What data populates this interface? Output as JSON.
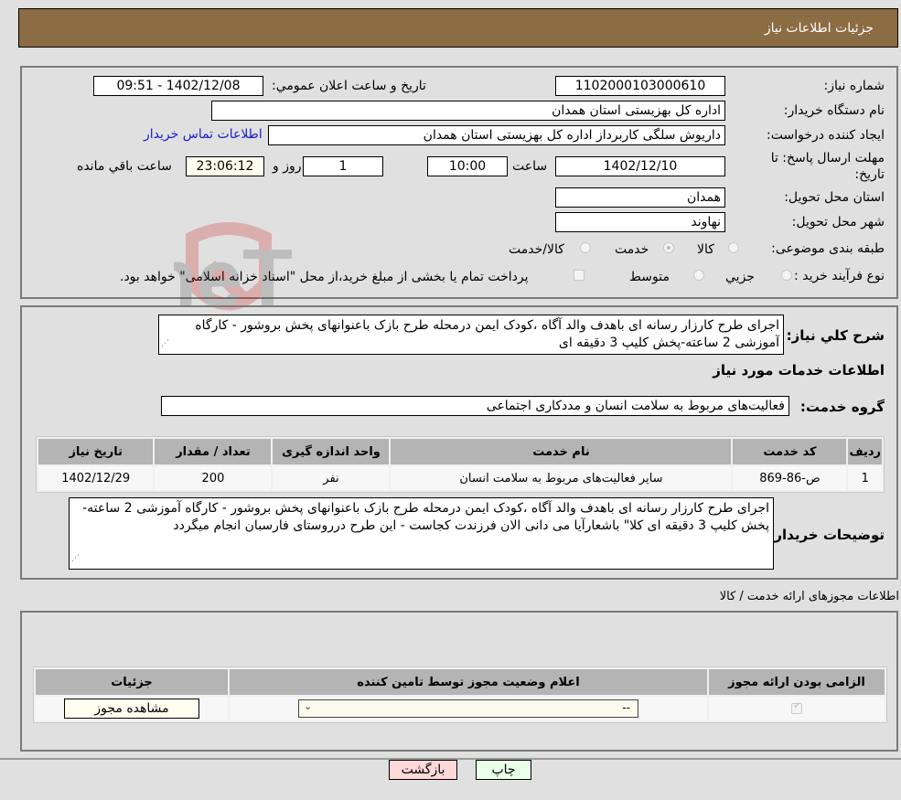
{
  "header": {
    "title": "جزئیات اطلاعات نیاز"
  },
  "details": {
    "need_number_label": "شماره نیاز:",
    "need_number": "1102000103000610",
    "announce_label": "تاریخ و ساعت اعلان عمومي:",
    "announce_value": "1402/12/08 - 09:51",
    "buyer_org_label": "نام دستگاه خریدار:",
    "buyer_org": "اداره کل بهزیستی استان همدان",
    "creator_label": "ایجاد کننده درخواست:",
    "creator": "داریوش سلگی کاربرداز اداره کل بهزیستی استان همدان",
    "contact_link": "اطلاعات تماس خریدار",
    "deadline_label": "مهلت ارسال پاسخ: تا تاریخ:",
    "deadline_date": "1402/12/10",
    "time_label": "ساعت",
    "deadline_time": "10:00",
    "days_value": "1",
    "days_label": "روز و",
    "remaining_time": "23:06:12",
    "remaining_label": "ساعت باقي مانده",
    "province_label": "استان محل تحویل:",
    "province": "همدان",
    "city_label": "شهر محل تحویل:",
    "city": "نهاوند",
    "category_label": "طبقه بندی موضوعی:",
    "category_options": [
      "کالا",
      "خدمت",
      "کالا/خدمت"
    ],
    "category_selected": "خدمت",
    "process_label": "نوع فرآیند خرید :",
    "process_options": [
      "جزيي",
      "متوسط"
    ],
    "treasury_note": "پرداخت تمام یا بخشی از مبلغ خرید،از محل \"اسناد خزانه اسلامی\" خواهد بود."
  },
  "summary": {
    "description_label": "شرح كلي نياز:",
    "description": "اجرای طرح کارزار رسانه ای باهدف والد آگاه ،کودک ایمن درمحله طرح بازک باعنوانهای پخش بروشور - کارگاه آموزشی 2 ساعته-پخش کلیپ 3 دقیقه ای",
    "services_heading": "اطلاعات خدمات مورد نیاز",
    "service_group_label": "گروه خدمت:",
    "service_group": "فعالیت‌های مربوط به سلامت انسان و مددکاری اجتماعی",
    "table": {
      "headers": [
        "ردیف",
        "کد خدمت",
        "نام خدمت",
        "واحد اندازه گیری",
        "تعداد / مقدار",
        "تاریخ نیاز"
      ],
      "rows": [
        [
          "1",
          "ص-86-869",
          "سایر فعالیت‌های مربوط به سلامت انسان",
          "نفر",
          "200",
          "1402/12/29"
        ]
      ]
    },
    "buyer_notes_label": "توضیحات خریدار:",
    "buyer_notes": "اجرای طرح کارزار رسانه ای باهدف والد آگاه ،کودک ایمن درمحله طرح بازک باعنوانهای پخش بروشور - کارگاه آموزشی 2 ساعته-پخش کلیپ 3 دقیقه ای کلا\" باشعارآیا می دانی الان فرزندت کجاست - این طرح درروستای فارسبان انجام میگردد"
  },
  "permits": {
    "title": "اطلاعات مجوزهای ارائه خدمت / کالا",
    "headers": [
      "الزامی بودن ارائه مجوز",
      "اعلام وضعیت مجوز توسط تامین کننده",
      "جزئیات"
    ],
    "select_value": "--",
    "view_button": "مشاهده مجوز"
  },
  "actions": {
    "print": "چاپ",
    "back": "بازگشت"
  },
  "colors": {
    "header_bg": "#8c6c42",
    "back_bg": "#ffd8d8",
    "print_bg": "#e8ffe8",
    "link": "#1a1acc"
  }
}
